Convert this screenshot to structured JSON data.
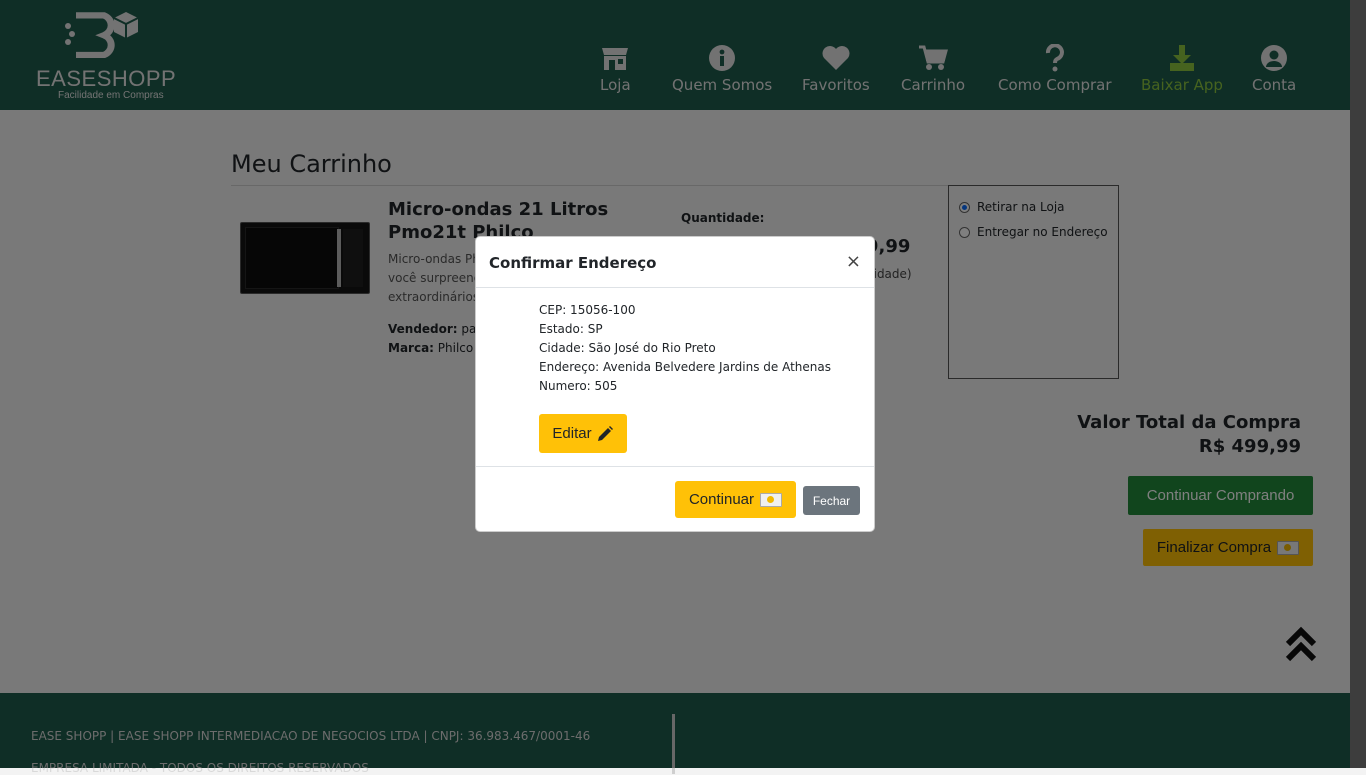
{
  "brand": {
    "name": "EASESHOPP",
    "tagline": "Facilidade em Compras"
  },
  "nav": [
    {
      "label": "Loja",
      "icon": "store-icon"
    },
    {
      "label": "Quem Somos",
      "icon": "info-icon"
    },
    {
      "label": "Favoritos",
      "icon": "heart-icon"
    },
    {
      "label": "Carrinho",
      "icon": "cart-icon"
    },
    {
      "label": "Como Comprar",
      "icon": "question-icon"
    },
    {
      "label": "Baixar App",
      "icon": "download-icon"
    },
    {
      "label": "Conta",
      "icon": "user-icon"
    }
  ],
  "cart": {
    "title": "Meu Carrinho",
    "product": {
      "title": "Micro-ondas 21 Litros Pmo21t Philco",
      "description": [
        "Micro-ondas Ph",
        "você surpreend",
        "extraordinários"
      ],
      "seller_label": "Vendedor:",
      "seller_value": "parc",
      "brand_label": "Marca:",
      "brand_value": "Philco",
      "quantity_label": "Quantidade:",
      "price_partial": "9,99",
      "unit_partial": "nidade)"
    },
    "delivery_options": [
      {
        "label": "Retirar na Loja",
        "checked": true
      },
      {
        "label": "Entregar no Endereço",
        "checked": false
      }
    ],
    "total_label": "Valor Total da Compra",
    "total_value": "R$ 499,99",
    "continue_shopping": "Continuar Comprando",
    "finalize": "Finalizar Compra"
  },
  "footer": {
    "line1": "EASE SHOPP | EASE SHOPP INTERMEDIACAO DE NEGOCIOS LTDA | CNPJ: 36.983.467/0001-46",
    "line2": "EMPRESA LIMITADA - TODOS OS DIREITOS RESERVADOS"
  },
  "modal": {
    "title": "Confirmar Endereço",
    "close_symbol": "×",
    "lines": [
      "CEP: 15056-100",
      "Estado: SP",
      "Cidade: São José do Rio Preto",
      "Endereço: Avenida Belvedere Jardins de Athenas",
      "Numero: 505"
    ],
    "edit": "Editar",
    "continue": "Continuar",
    "close": "Fechar"
  },
  "colors": {
    "header": "#1f5c4c",
    "highlight": "#8cc63f",
    "warning": "#ffc107",
    "success": "#228b3a",
    "secondary": "#6c757d"
  }
}
